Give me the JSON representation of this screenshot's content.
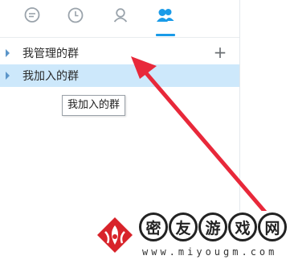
{
  "tabs": [
    {
      "name": "messages",
      "icon": "chat-bubble-icon"
    },
    {
      "name": "recent",
      "icon": "clock-icon"
    },
    {
      "name": "contacts",
      "icon": "person-icon"
    },
    {
      "name": "groups",
      "icon": "group-icon",
      "active": true
    }
  ],
  "groups": [
    {
      "label": "我管理的群",
      "add_label": "+"
    },
    {
      "label": "我加入的群",
      "selected": true
    }
  ],
  "tooltip": {
    "text": "我加入的群"
  },
  "watermark": {
    "chars": [
      "密",
      "友",
      "游",
      "戏",
      "网"
    ],
    "url": "www.miyougm.com"
  },
  "colors": {
    "accent": "#1a9be8",
    "selected_row": "#cde8fb",
    "annotation_arrow": "#e8283a"
  }
}
